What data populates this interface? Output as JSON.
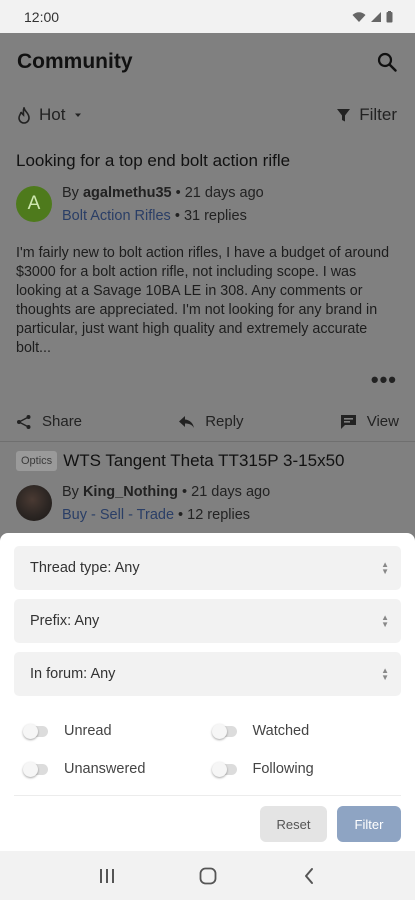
{
  "status": {
    "time": "12:00"
  },
  "header": {
    "title": "Community",
    "search_icon": "search-icon"
  },
  "sort": {
    "label": "Hot",
    "filter_label": "Filter"
  },
  "thread1": {
    "title": "Looking for a top end bolt action rifle",
    "avatar_letter": "A",
    "by": "By ",
    "author": "agalmethu35",
    "age": " • 21 days ago",
    "forum": "Bolt Action Rifles",
    "replies": " • 31 replies",
    "body": "I'm fairly new to bolt action rifles, I have a budget of around $3000 for a bolt action rifle, not including scope. I was looking at a Savage 10BA LE in 308. Any comments or thoughts are appreciated. I'm not looking for any brand in particular, just want high quality and extremely accurate bolt...",
    "more": "•••",
    "actions": {
      "share": "Share",
      "reply": "Reply",
      "view": "View"
    }
  },
  "thread2": {
    "prefix": "Optics",
    "title": "WTS Tangent Theta TT315P 3-15x50",
    "by": "By ",
    "author": "King_Nothing",
    "age": " • 21 days ago",
    "forum": "Buy - Sell - Trade",
    "replies": " • 12 replies"
  },
  "filter_sheet": {
    "thread_type": "Thread type: Any",
    "prefix": "Prefix: Any",
    "in_forum": "In forum: Any",
    "toggles": {
      "unread": "Unread",
      "watched": "Watched",
      "unanswered": "Unanswered",
      "following": "Following"
    },
    "reset": "Reset",
    "filter": "Filter"
  },
  "colors": {
    "scrim": "#808080",
    "sheet": "#ffffff",
    "filter_button": "#8ea4c3",
    "reset_button": "#e4e4e4",
    "avatar": "#4e7a1c"
  }
}
